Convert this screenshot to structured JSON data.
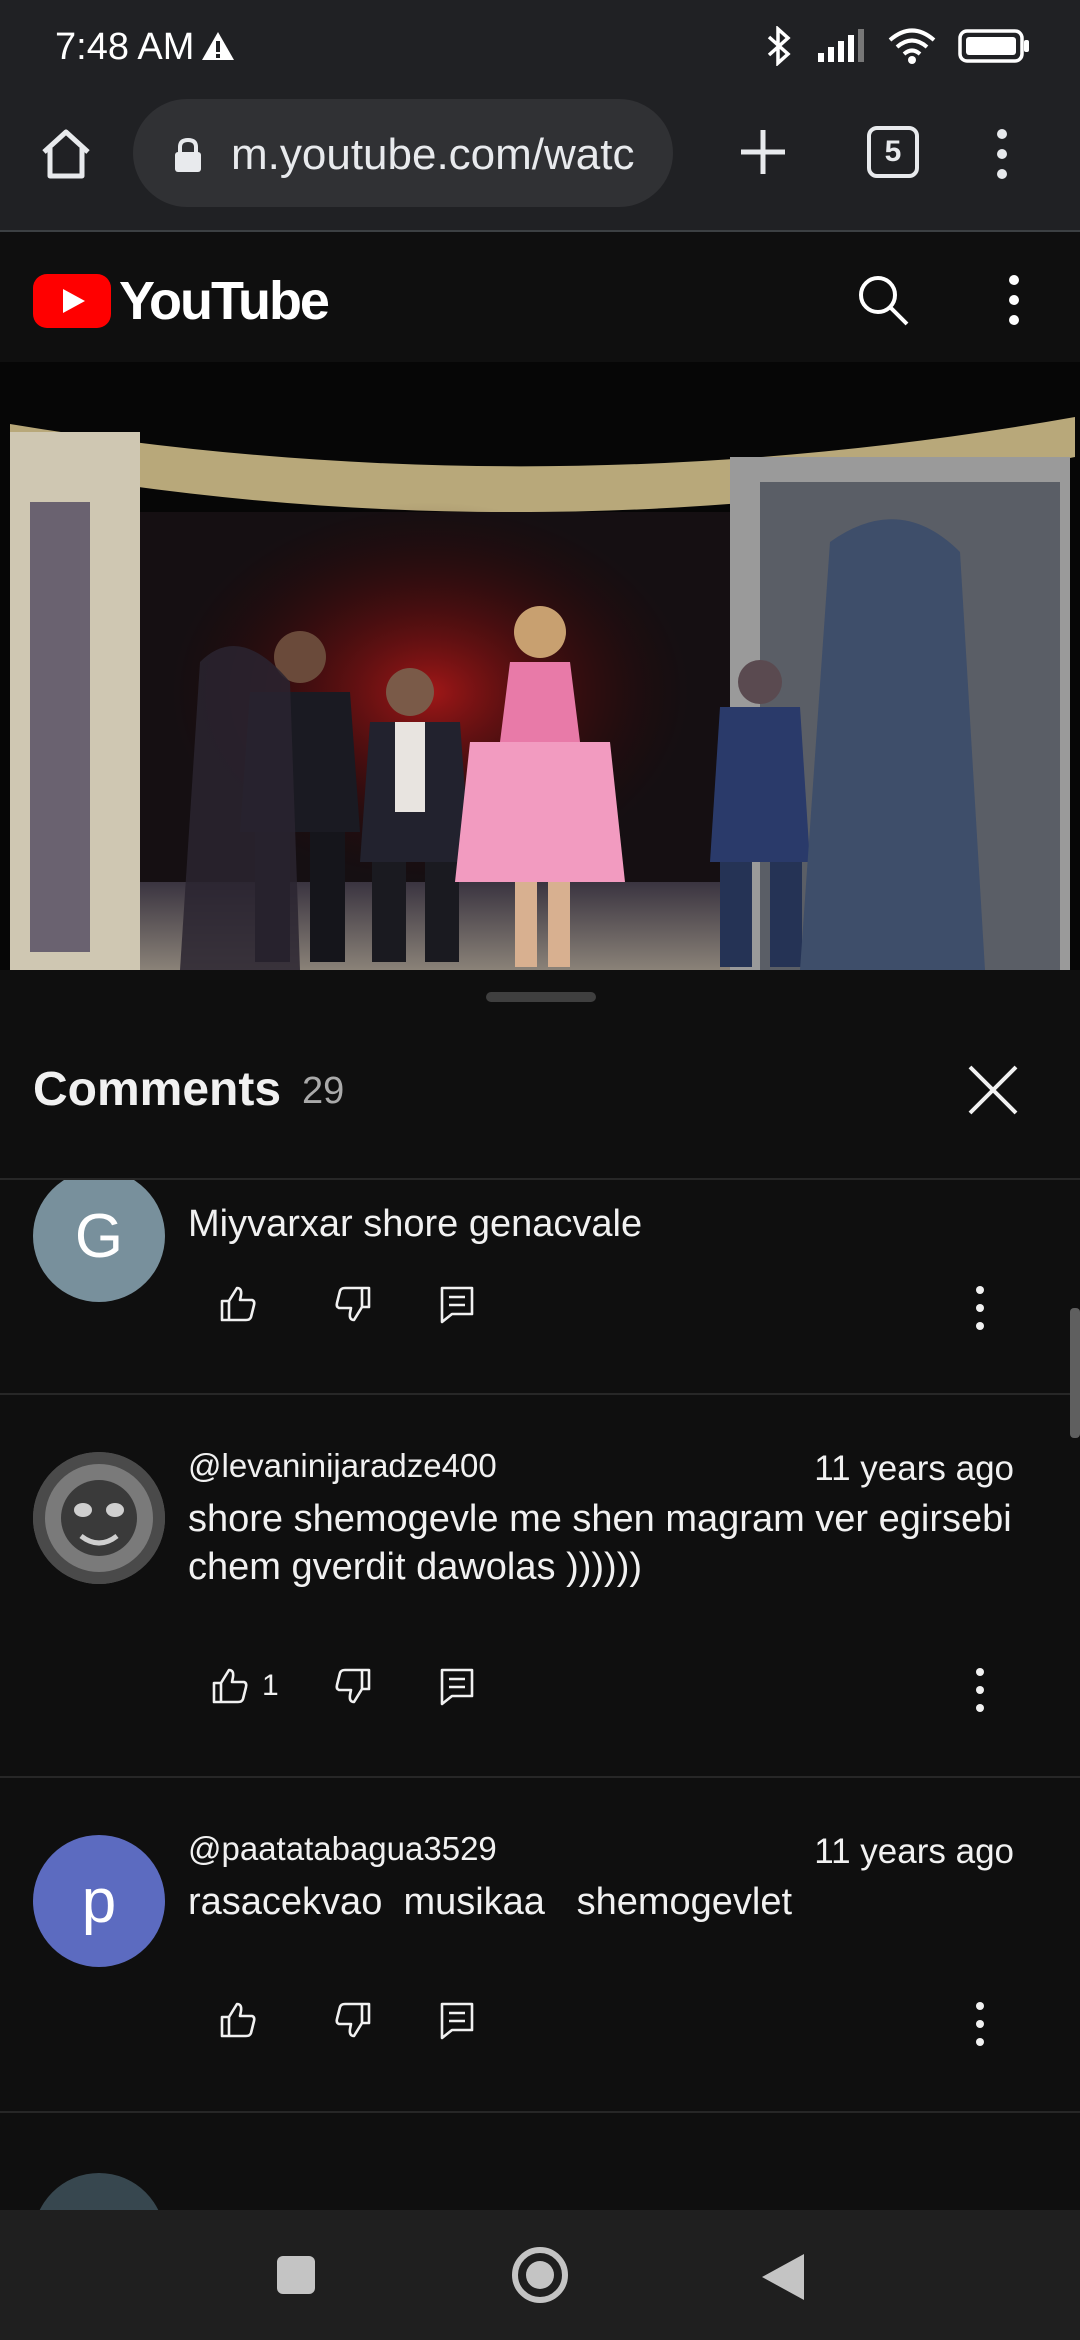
{
  "status_bar": {
    "time": "7:48 AM",
    "icons": [
      "alert-icon",
      "bluetooth-icon",
      "signal-icon",
      "wifi-icon",
      "battery-icon"
    ]
  },
  "browser": {
    "url": "m.youtube.com/watc",
    "tab_count": "5",
    "icons": [
      "home-icon",
      "lock-icon",
      "plus-icon",
      "tabs-icon",
      "more-vert-icon"
    ]
  },
  "youtube_header": {
    "logo_text": "YouTube",
    "icons": [
      "search-icon",
      "more-vert-icon"
    ],
    "brand_color": "#ff0000"
  },
  "comments_panel": {
    "title": "Comments",
    "count": "29",
    "comments": [
      {
        "avatar_letter": "G",
        "avatar_color": "#78909c",
        "author": "",
        "time": "",
        "text": "Miyvarxar shore genacvale",
        "likes": ""
      },
      {
        "avatar_letter": "",
        "avatar_color": "#6a6a6a",
        "author": "@levaninijaradze400",
        "time": "11 years ago",
        "text": "shore shemogevle me shen magram ver egirsebi chem gverdit dawolas ))))))",
        "likes": "1"
      },
      {
        "avatar_letter": "p",
        "avatar_color": "#5c6bc0",
        "author": "@paatatabagua3529",
        "time": "11 years ago",
        "text": "rasacekvao  musikaa   shemogevlet",
        "likes": ""
      }
    ]
  },
  "navigation_bar": {
    "icons": [
      "recents-icon",
      "home-circle-icon",
      "back-icon"
    ]
  }
}
